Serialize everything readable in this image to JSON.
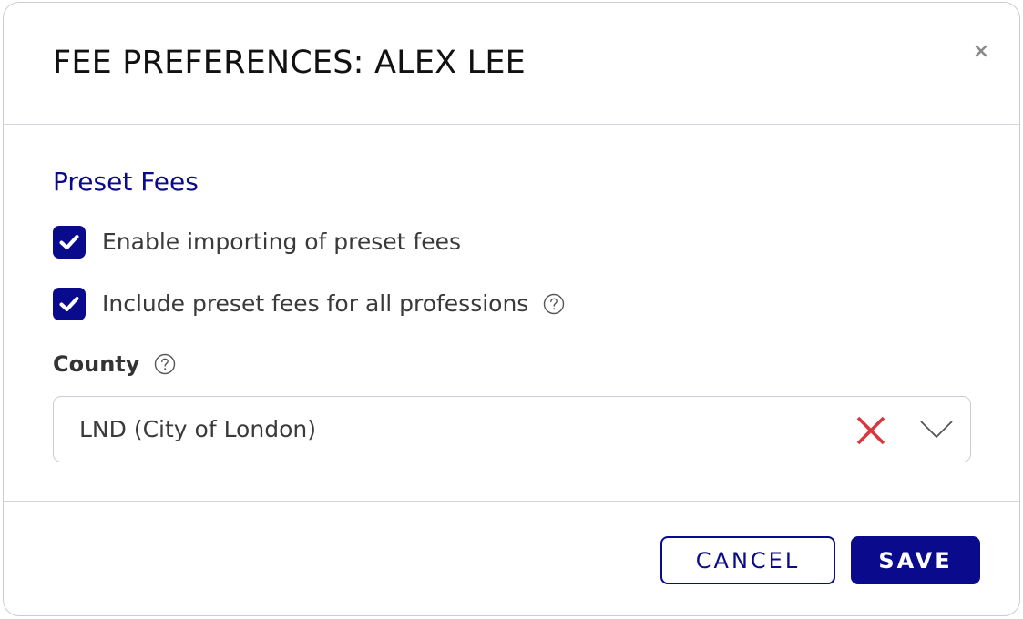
{
  "dialog": {
    "title": "FEE PREFERENCES: ALEX LEE",
    "close_label": "×"
  },
  "preset_fees": {
    "section_title": "Preset Fees",
    "options": [
      {
        "label": "Enable importing of preset fees",
        "checked": true
      },
      {
        "label": "Include preset fees for all professions",
        "checked": true,
        "has_help": true
      }
    ]
  },
  "county": {
    "label": "County",
    "selected_value": "LND (City of London)"
  },
  "footer": {
    "cancel_label": "CANCEL",
    "save_label": "SAVE"
  },
  "colors": {
    "primary": "#0a0a8c",
    "clear_icon": "#d9363e",
    "border": "#c9cdd3"
  },
  "icons": {
    "close": "close-icon",
    "check": "check-icon",
    "help": "help-circle-icon",
    "clear": "clear-icon",
    "dropdown": "chevron-down-icon"
  }
}
